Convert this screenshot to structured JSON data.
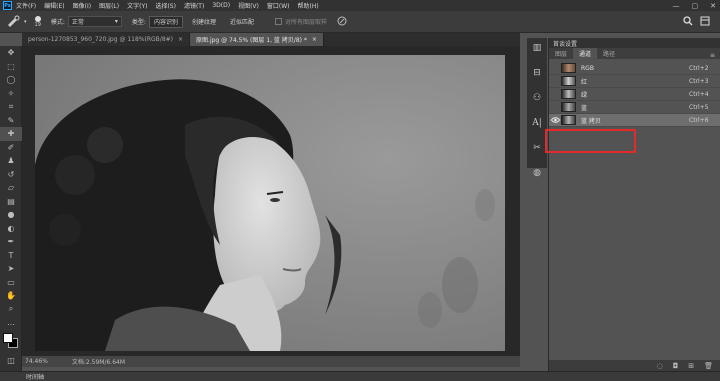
{
  "menubar": {
    "logo": "Ps",
    "items": [
      "文件(F)",
      "编辑(E)",
      "图像(I)",
      "图层(L)",
      "文字(Y)",
      "选择(S)",
      "滤镜(T)",
      "3D(D)",
      "视图(V)",
      "窗口(W)",
      "帮助(H)"
    ],
    "window_controls": [
      "—",
      "▢",
      "✕"
    ]
  },
  "options": {
    "brush_size": "19",
    "mode_label": "模式:",
    "mode_value": "正常",
    "type_label": "类型:",
    "type_options": [
      "内容识别",
      "创建纹理",
      "近似匹配"
    ],
    "sample_all": "对所有图层取样"
  },
  "tabs": [
    {
      "label": "person-1270853_960_720.jpg @ 118%(RGB/8#)",
      "close": "×"
    },
    {
      "label": "原图.jpg @ 74.5% (图层 1, 蓝 拷贝/8) *",
      "close": "×"
    }
  ],
  "status": {
    "zoom": "74.46%",
    "doc": "文档:2.59M/6.64M"
  },
  "timeline_label": "时间轴",
  "panel": {
    "header": "首谈设置",
    "tabs": [
      "图层",
      "通道",
      "路径"
    ],
    "channels": [
      {
        "name": "RGB",
        "shortcut": "Ctrl+2",
        "visible": false
      },
      {
        "name": "红",
        "shortcut": "Ctrl+3",
        "visible": false
      },
      {
        "name": "绿",
        "shortcut": "Ctrl+4",
        "visible": false
      },
      {
        "name": "蓝",
        "shortcut": "Ctrl+5",
        "visible": false
      },
      {
        "name": "蓝 拷贝",
        "shortcut": "Ctrl+6",
        "visible": true
      }
    ],
    "footer_icons": [
      "dotted-circle-icon",
      "channel-mask-icon",
      "new-channel-icon",
      "trash-icon"
    ]
  },
  "colors": {
    "highlight": "#e32a2a",
    "accent": "#31a8ff"
  }
}
